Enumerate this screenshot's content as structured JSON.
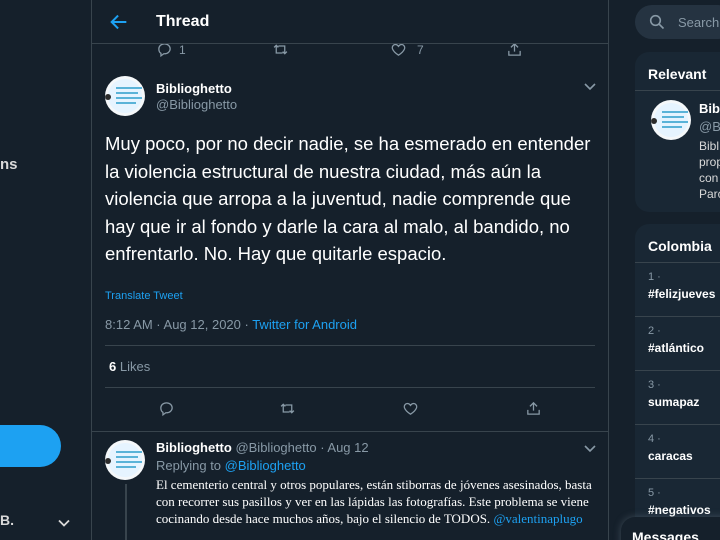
{
  "left": {
    "partial_label": "ns",
    "account_partial": "B."
  },
  "header": {
    "title": "Thread"
  },
  "prev_tweet_actions": {
    "replies": "1",
    "likes": "7"
  },
  "tweet": {
    "display_name": "Biblioghetto",
    "handle": "@Biblioghetto",
    "text": "Muy poco, por no decir nadie, se ha esmerado en entender la violencia estructural de nuestra ciudad, más aún la violencia que arropa a la juventud, nadie comprende que hay que ir al fondo y darle la cara al malo, al bandido, no enfrentarlo. No. Hay que quitarle espacio.",
    "translate_label": "Translate Tweet",
    "timestamp": "8:12 AM · Aug 12, 2020 · ",
    "source": "Twitter for Android",
    "likes_count": "6",
    "likes_label": " Likes"
  },
  "reply": {
    "display_name": "Biblioghetto",
    "handle_date": " @Biblioghetto · Aug 12",
    "replying_prefix": "Replying to ",
    "replying_to": "@Biblioghetto",
    "text": "El cementerio central y otros populares, están stiborras de jóvenes asesinados, basta con recorrer sus pasillos y ver en las lápidas las fotografías. Este problema se viene cocinando desde hace muchos años, bajo el silencio de TODOS. ",
    "mention": "@valentinaplugo"
  },
  "right": {
    "search_placeholder": "Search",
    "relevant_title": "Relevant",
    "relevant_name": "Bibl",
    "relevant_handle": "@Bi",
    "relevant_bio": [
      "Bibl",
      "prop",
      "con",
      "Parc"
    ],
    "trends_title": "Colombia",
    "trends": [
      {
        "rank": "1 ·",
        "name": "#felizjueves"
      },
      {
        "rank": "2 ·",
        "name": "#atlántico"
      },
      {
        "rank": "3 ·",
        "name": "sumapaz"
      },
      {
        "rank": "4 ·",
        "name": "caracas"
      },
      {
        "rank": "5 ·",
        "name": "#negativos"
      }
    ],
    "messages_title": "Messages"
  },
  "colors": {
    "background": "#15202b",
    "accent": "#1da1f2",
    "muted": "#8899a6",
    "border": "#38444d"
  }
}
